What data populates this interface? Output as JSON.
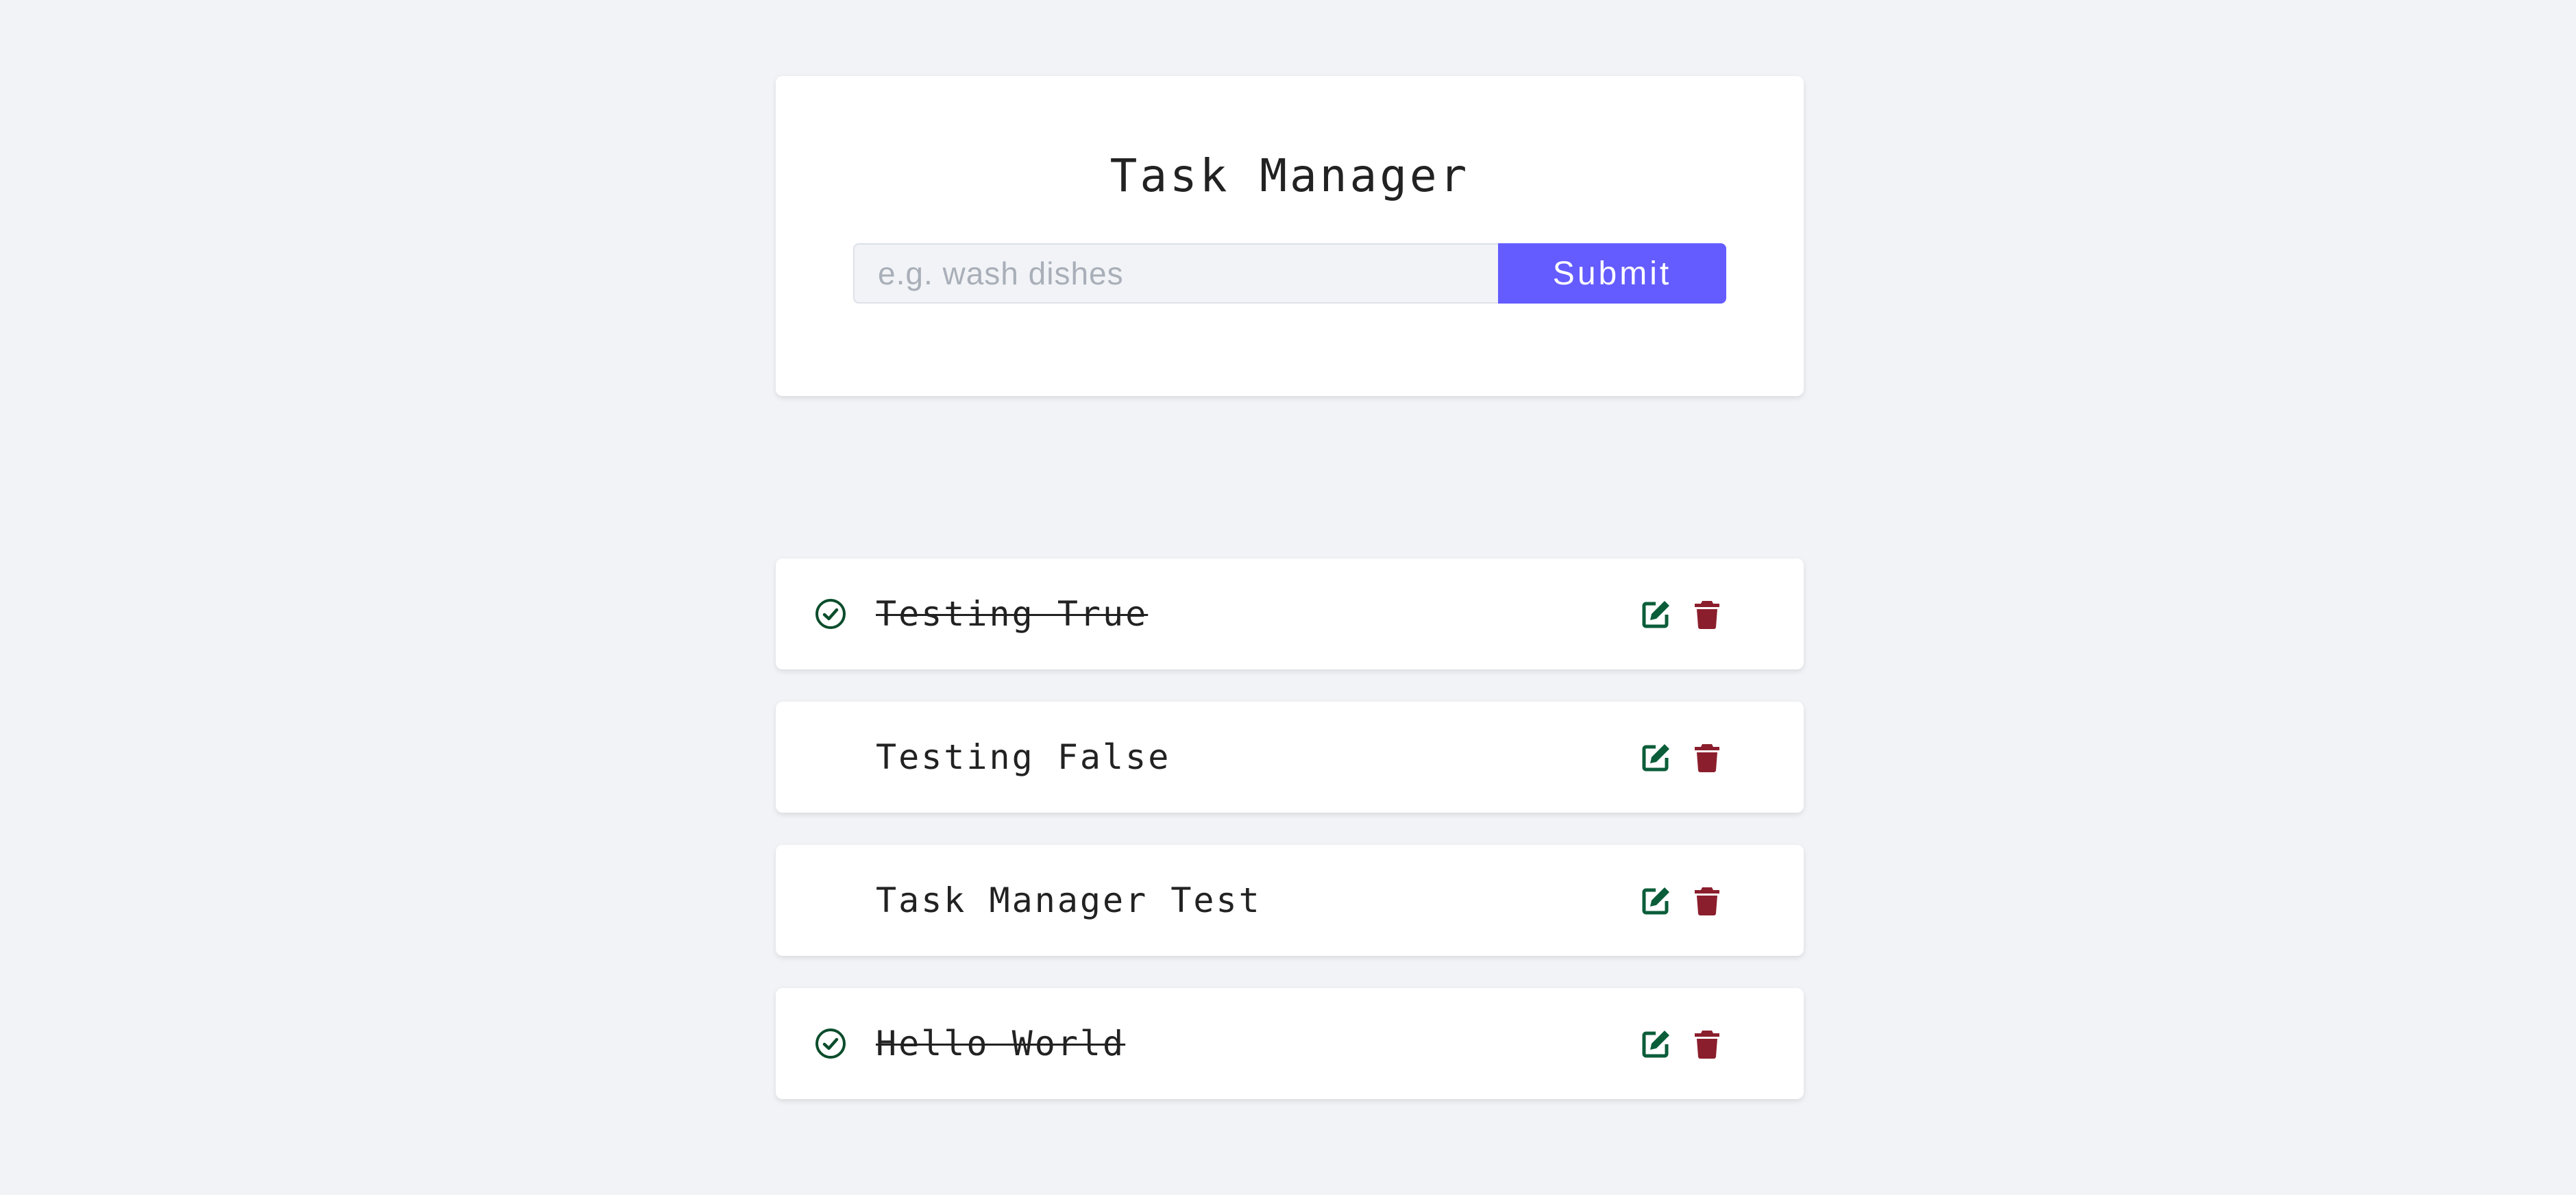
{
  "app": {
    "title": "Task Manager"
  },
  "form": {
    "input_value": "",
    "input_placeholder": "e.g. wash dishes",
    "submit_label": "Submit"
  },
  "colors": {
    "accent": "#645cff",
    "edit_icon": "#0b5d3a",
    "delete_icon": "#8b1e2d",
    "check_icon": "#0b4d2c"
  },
  "tasks": [
    {
      "title": "Testing True",
      "completed": true,
      "icons": [
        "check-circle-icon",
        "edit-icon",
        "trash-icon"
      ]
    },
    {
      "title": "Testing False",
      "completed": false,
      "icons": [
        "edit-icon",
        "trash-icon"
      ]
    },
    {
      "title": "Task Manager Test",
      "completed": false,
      "icons": [
        "edit-icon",
        "trash-icon"
      ]
    },
    {
      "title": "Hello World",
      "completed": true,
      "icons": [
        "check-circle-icon",
        "edit-icon",
        "trash-icon"
      ]
    }
  ]
}
